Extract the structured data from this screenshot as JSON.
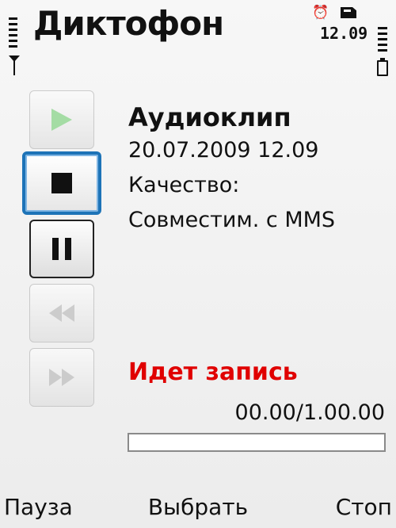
{
  "header": {
    "title": "Диктофон",
    "clock": "12.09",
    "icons": [
      "signal-strength-icon",
      "antenna-icon",
      "alarm-icon",
      "memory-card-icon",
      "battery-icon"
    ]
  },
  "controls": [
    {
      "name": "play",
      "icon": "play-icon",
      "state": "disabled"
    },
    {
      "name": "stop",
      "icon": "stop-icon",
      "state": "focused"
    },
    {
      "name": "pause",
      "icon": "pause-icon",
      "state": "active"
    },
    {
      "name": "rewind",
      "icon": "rewind-icon",
      "state": "disabled"
    },
    {
      "name": "fast-forward",
      "icon": "fast-forward-icon",
      "state": "disabled"
    }
  ],
  "clip": {
    "name": "Аудиоклип",
    "datetime": "20.07.2009 12.09",
    "quality_label": "Качество:",
    "quality_value": "Совместим. с MMS"
  },
  "recording": {
    "status": "Идет запись",
    "time": "00.00/1.00.00",
    "progress": 0
  },
  "softkeys": {
    "left": "Пауза",
    "center": "Выбрать",
    "right": "Стоп"
  },
  "colors": {
    "focus": "#1d73b7",
    "recording": "#e00000",
    "play_disabled": "#7ad07a"
  }
}
